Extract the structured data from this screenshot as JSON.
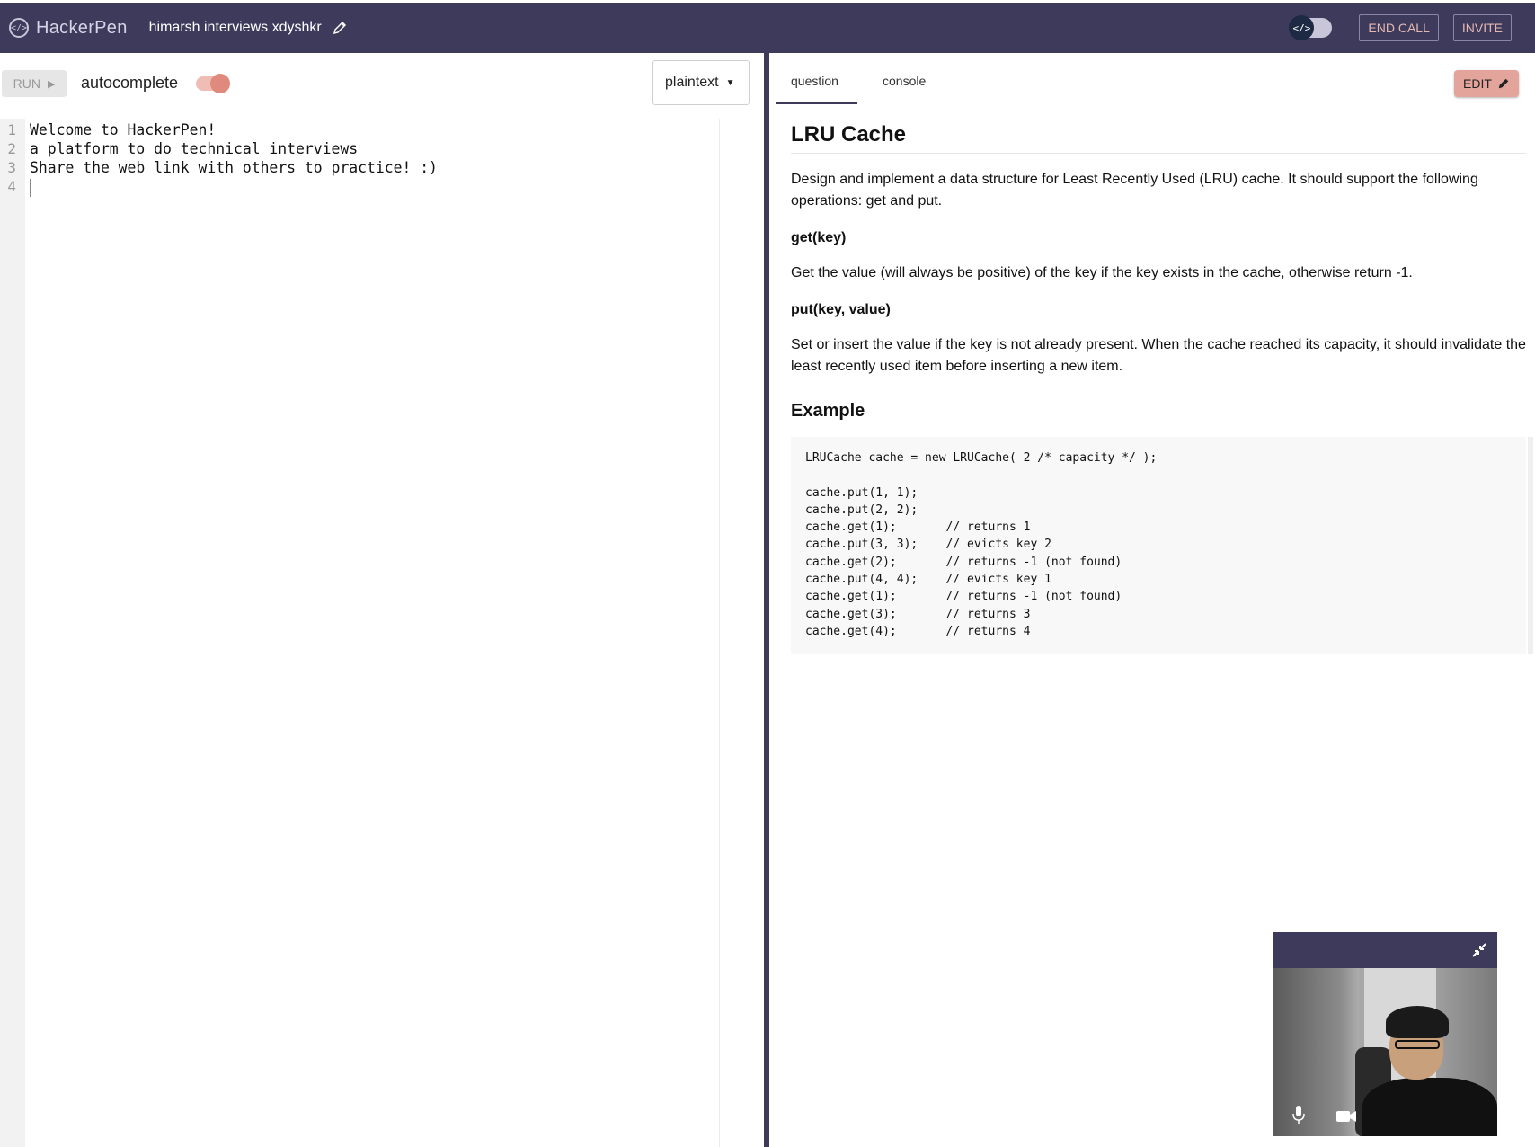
{
  "header": {
    "logo_text": "HackerPen",
    "logo_glyph": "</>",
    "session_title": "himarsh interviews xdyshkr",
    "toggle_glyph": "</>",
    "end_call_label": "END CALL",
    "invite_label": "INVITE",
    "bg_color": "#3e3a5c"
  },
  "editor": {
    "run_label": "RUN",
    "autocomplete_label": "autocomplete",
    "autocomplete_on": true,
    "language": "plaintext",
    "lines": [
      "Welcome to HackerPen!",
      "a platform to do technical interviews",
      "Share the web link with others to practice! :)",
      ""
    ],
    "line_numbers": [
      "1",
      "2",
      "3",
      "4"
    ]
  },
  "question_panel": {
    "tabs": [
      {
        "label": "question",
        "active": true
      },
      {
        "label": "console",
        "active": false
      }
    ],
    "edit_label": "EDIT",
    "title": "LRU Cache",
    "intro": "Design and implement a data structure for Least Recently Used (LRU) cache. It should support the following operations: get and put.",
    "get_heading": "get(key)",
    "get_desc": "Get the value (will always be positive) of the key if the key exists in the cache, otherwise return -1.",
    "put_heading": "put(key, value)",
    "put_desc": "Set or insert the value if the key is not already present. When the cache reached its capacity, it should invalidate the least recently used item before inserting a new item.",
    "example_heading": "Example",
    "example_code": "LRUCache cache = new LRUCache( 2 /* capacity */ );\n\ncache.put(1, 1);\ncache.put(2, 2);\ncache.get(1);       // returns 1\ncache.put(3, 3);    // evicts key 2\ncache.get(2);       // returns -1 (not found)\ncache.put(4, 4);    // evicts key 1\ncache.get(1);       // returns -1 (not found)\ncache.get(3);       // returns 3\ncache.get(4);       // returns 4"
  },
  "video": {
    "icons": [
      "minimize-icon",
      "microphone-icon",
      "camera-icon"
    ]
  },
  "colors": {
    "accent": "#e3a49b",
    "toggle_knob": "#e08a7e",
    "divider": "#3e3a5c"
  }
}
